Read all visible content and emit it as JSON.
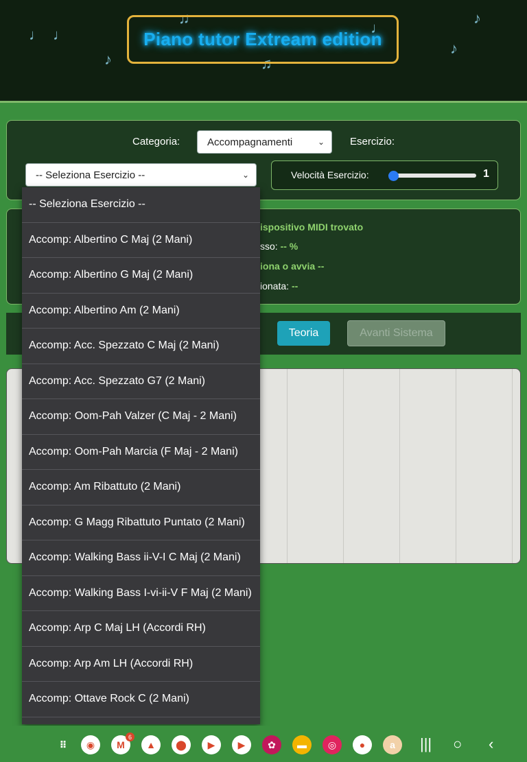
{
  "header": {
    "title": "Piano tutor Extream edition",
    "notes": [
      "♩",
      "♩",
      "♫",
      "♪",
      "♩",
      "♪",
      "♪",
      "♫"
    ]
  },
  "controls": {
    "category_label": "Categoria:",
    "category_value": "Accompagnamenti",
    "exercise_label": "Esercizio:",
    "exercise_value": "-- Seleziona Esercizio --",
    "speed_label": "Velocità Esercizio:",
    "speed_value": "1",
    "speed_fraction": 0.0
  },
  "status": {
    "midi": "ispositivo MIDI trovato",
    "progress_label": "sso:",
    "progress_value": "-- %",
    "action": "iona o avvia --",
    "selected_label": "ionata:",
    "selected_value": "--"
  },
  "toolbar": {
    "teoria": "Teoria",
    "avanti": "Avanti Sistema"
  },
  "dropdown": {
    "items": [
      "-- Seleziona Esercizio --",
      "Accomp: Albertino C Maj (2 Mani)",
      "Accomp: Albertino G Maj (2 Mani)",
      "Accomp: Albertino Am (2 Mani)",
      "Accomp: Acc. Spezzato C Maj (2 Mani)",
      "Accomp: Acc. Spezzato G7 (2 Mani)",
      "Accomp: Oom-Pah Valzer (C Maj - 2 Mani)",
      "Accomp: Oom-Pah Marcia (F Maj - 2 Mani)",
      "Accomp: Am Ribattuto (2 Mani)",
      "Accomp: G Magg Ribattuto Puntato (2 Mani)",
      "Accomp: Walking Bass ii-V-I C Maj (2 Mani)",
      "Accomp: Walking Bass I-vi-ii-V F Maj (2 Mani)",
      "Accomp: Arp C Maj LH (Accordi RH)",
      "Accomp: Arp Am LH (Accordi RH)",
      "Accomp: Ottave Rock C (2 Mani)"
    ]
  },
  "taskbar": {
    "gmail_badge": "6",
    "apps": [
      {
        "name": "app-drawer-icon",
        "color": "#3a8f3e",
        "glyph": "⠿"
      },
      {
        "name": "chrome-icon",
        "color": "#ffffff",
        "glyph": "◉"
      },
      {
        "name": "gmail-icon",
        "color": "#ffffff",
        "glyph": "M"
      },
      {
        "name": "drive-icon",
        "color": "#ffffff",
        "glyph": "▲"
      },
      {
        "name": "maps-icon",
        "color": "#ffffff",
        "glyph": "⬤"
      },
      {
        "name": "play-store-icon",
        "color": "#ffffff",
        "glyph": "▶"
      },
      {
        "name": "youtube-icon",
        "color": "#ffffff",
        "glyph": "▶"
      },
      {
        "name": "flower-app-icon",
        "color": "#c2185b",
        "glyph": "✿"
      },
      {
        "name": "files-icon",
        "color": "#f4b400",
        "glyph": "▬"
      },
      {
        "name": "camera-icon",
        "color": "#e0245e",
        "glyph": "◎"
      },
      {
        "name": "messages-icon",
        "color": "#ffffff",
        "glyph": "●"
      },
      {
        "name": "amazon-icon",
        "color": "#f2d1a8",
        "glyph": "a"
      }
    ]
  }
}
